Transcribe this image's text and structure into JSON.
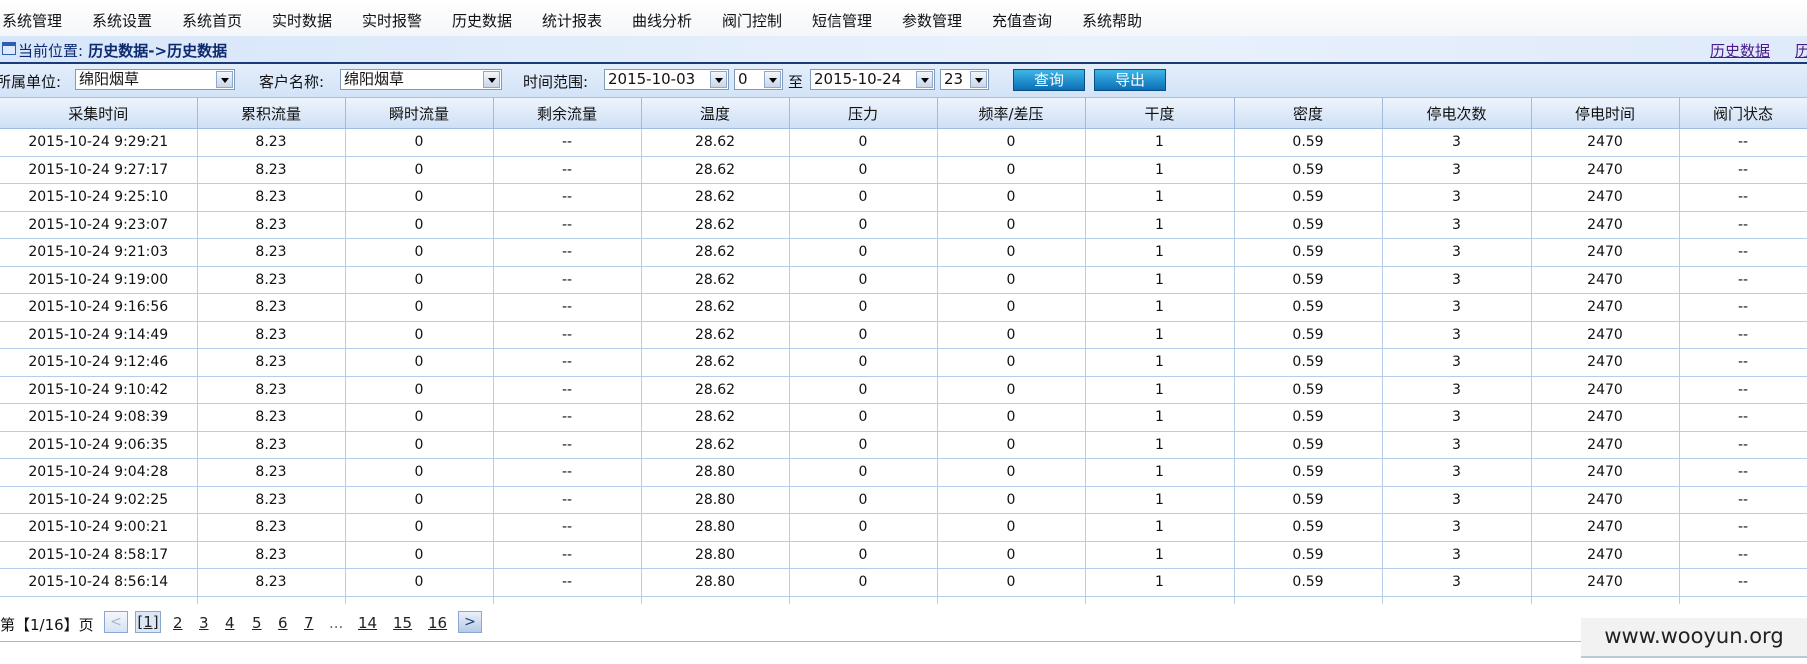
{
  "topmenu": [
    "系统管理",
    "系统设置",
    "系统首页",
    "实时数据",
    "实时报警",
    "历史数据",
    "统计报表",
    "曲线分析",
    "阀门控制",
    "短信管理",
    "参数管理",
    "充值查询",
    "系统帮助"
  ],
  "breadcrumb": {
    "label": "当前位置:",
    "path": "历史数据->历史数据",
    "right_link1": "历史数据",
    "right_link2": "历"
  },
  "filters": {
    "unit_label": "所属单位:",
    "unit_value": "绵阳烟草",
    "customer_label": "客户名称:",
    "customer_value": "绵阳烟草",
    "range_label": "时间范围:",
    "date_from": "2015-10-03",
    "hour_from": "0",
    "to_label": "至",
    "date_to": "2015-10-24",
    "hour_to": "23",
    "query_button": "查询",
    "export_button": "导出"
  },
  "table": {
    "headers": [
      "采集时间",
      "累积流量",
      "瞬时流量",
      "剩余流量",
      "温度",
      "压力",
      "频率/差压",
      "干度",
      "密度",
      "停电次数",
      "停电时间",
      "阀门状态"
    ],
    "rows": [
      [
        "2015-10-24 9:29:21",
        "8.23",
        "0",
        "--",
        "28.62",
        "0",
        "0",
        "1",
        "0.59",
        "3",
        "2470",
        "--"
      ],
      [
        "2015-10-24 9:27:17",
        "8.23",
        "0",
        "--",
        "28.62",
        "0",
        "0",
        "1",
        "0.59",
        "3",
        "2470",
        "--"
      ],
      [
        "2015-10-24 9:25:10",
        "8.23",
        "0",
        "--",
        "28.62",
        "0",
        "0",
        "1",
        "0.59",
        "3",
        "2470",
        "--"
      ],
      [
        "2015-10-24 9:23:07",
        "8.23",
        "0",
        "--",
        "28.62",
        "0",
        "0",
        "1",
        "0.59",
        "3",
        "2470",
        "--"
      ],
      [
        "2015-10-24 9:21:03",
        "8.23",
        "0",
        "--",
        "28.62",
        "0",
        "0",
        "1",
        "0.59",
        "3",
        "2470",
        "--"
      ],
      [
        "2015-10-24 9:19:00",
        "8.23",
        "0",
        "--",
        "28.62",
        "0",
        "0",
        "1",
        "0.59",
        "3",
        "2470",
        "--"
      ],
      [
        "2015-10-24 9:16:56",
        "8.23",
        "0",
        "--",
        "28.62",
        "0",
        "0",
        "1",
        "0.59",
        "3",
        "2470",
        "--"
      ],
      [
        "2015-10-24 9:14:49",
        "8.23",
        "0",
        "--",
        "28.62",
        "0",
        "0",
        "1",
        "0.59",
        "3",
        "2470",
        "--"
      ],
      [
        "2015-10-24 9:12:46",
        "8.23",
        "0",
        "--",
        "28.62",
        "0",
        "0",
        "1",
        "0.59",
        "3",
        "2470",
        "--"
      ],
      [
        "2015-10-24 9:10:42",
        "8.23",
        "0",
        "--",
        "28.62",
        "0",
        "0",
        "1",
        "0.59",
        "3",
        "2470",
        "--"
      ],
      [
        "2015-10-24 9:08:39",
        "8.23",
        "0",
        "--",
        "28.62",
        "0",
        "0",
        "1",
        "0.59",
        "3",
        "2470",
        "--"
      ],
      [
        "2015-10-24 9:06:35",
        "8.23",
        "0",
        "--",
        "28.62",
        "0",
        "0",
        "1",
        "0.59",
        "3",
        "2470",
        "--"
      ],
      [
        "2015-10-24 9:04:28",
        "8.23",
        "0",
        "--",
        "28.80",
        "0",
        "0",
        "1",
        "0.59",
        "3",
        "2470",
        "--"
      ],
      [
        "2015-10-24 9:02:25",
        "8.23",
        "0",
        "--",
        "28.80",
        "0",
        "0",
        "1",
        "0.59",
        "3",
        "2470",
        "--"
      ],
      [
        "2015-10-24 9:00:21",
        "8.23",
        "0",
        "--",
        "28.80",
        "0",
        "0",
        "1",
        "0.59",
        "3",
        "2470",
        "--"
      ],
      [
        "2015-10-24 8:58:17",
        "8.23",
        "0",
        "--",
        "28.80",
        "0",
        "0",
        "1",
        "0.59",
        "3",
        "2470",
        "--"
      ],
      [
        "2015-10-24 8:56:14",
        "8.23",
        "0",
        "--",
        "28.80",
        "0",
        "0",
        "1",
        "0.59",
        "3",
        "2470",
        "--"
      ]
    ]
  },
  "pager": {
    "prefix": "第【1/16】页",
    "prev": "<",
    "next": ">",
    "current": "[1]",
    "pages": [
      "2",
      "3",
      "4",
      "5",
      "6",
      "7"
    ],
    "ellipsis": "...",
    "last_pages": [
      "14",
      "15",
      "16"
    ]
  },
  "watermark": "www.wooyun.org"
}
